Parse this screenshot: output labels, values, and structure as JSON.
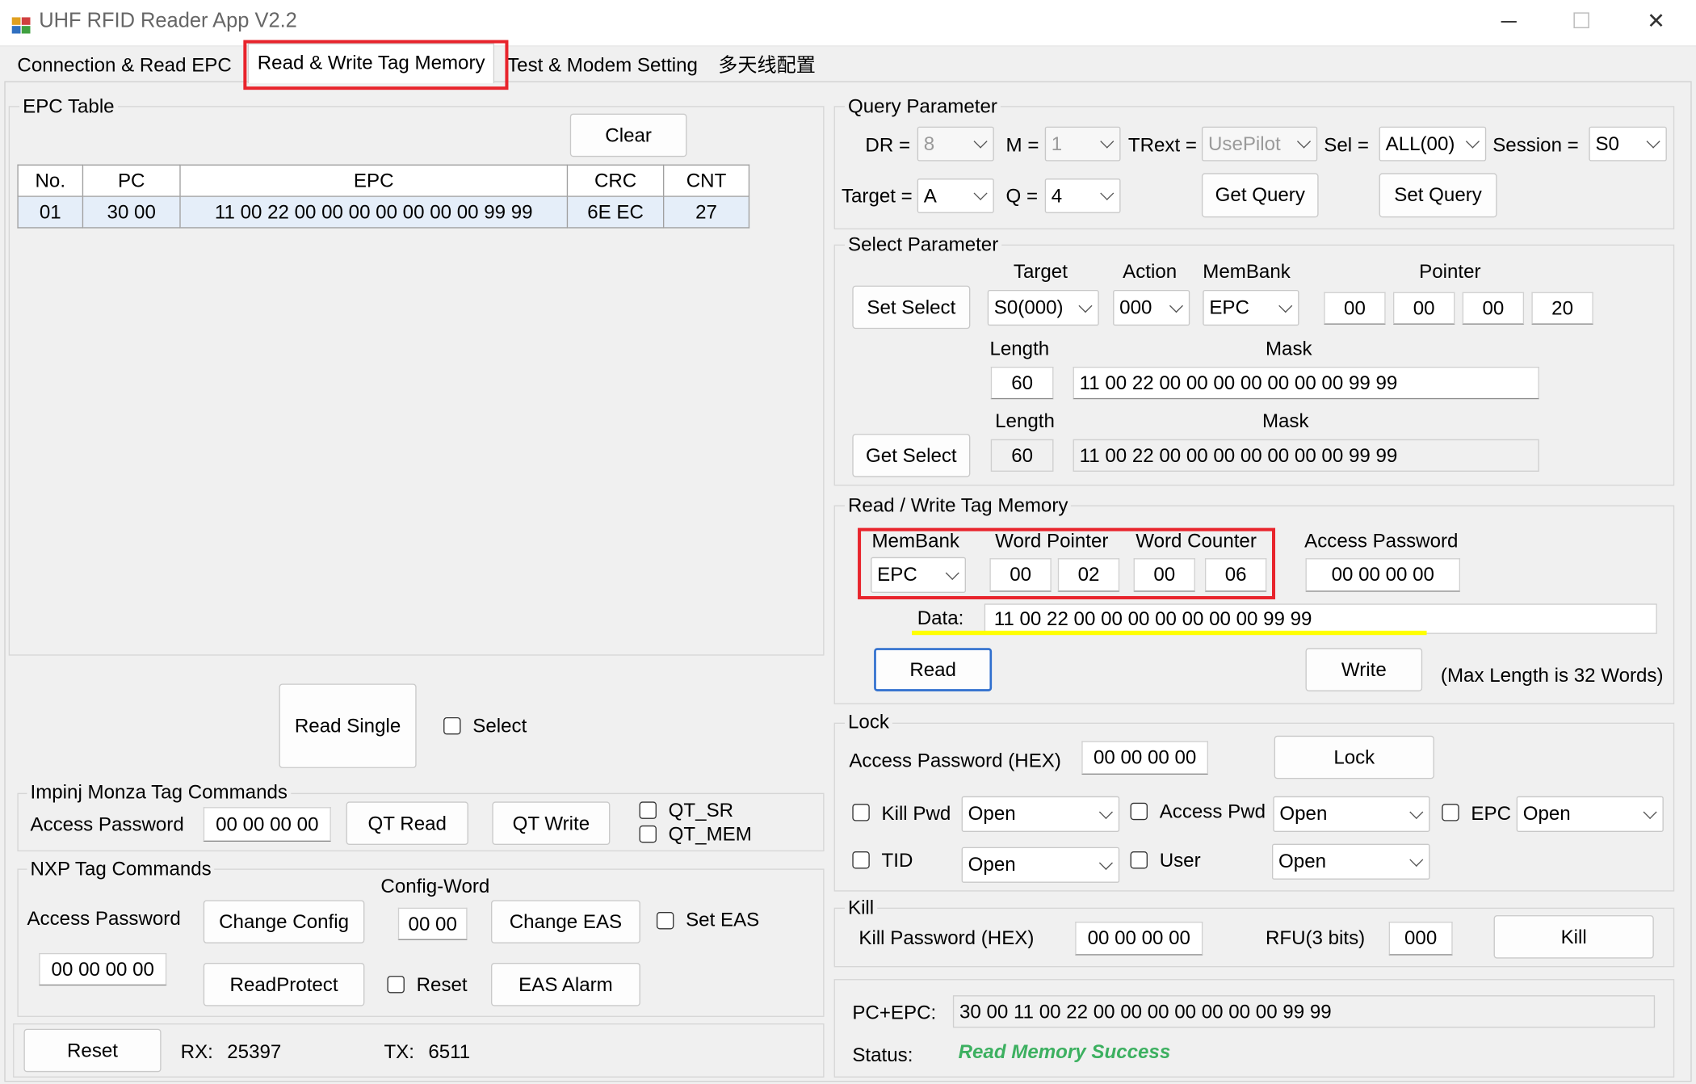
{
  "window": {
    "title": "UHF RFID Reader App V2.2",
    "min": "─",
    "max": "☐",
    "close": "✕"
  },
  "tabs": [
    "Connection & Read EPC",
    "Read & Write Tag Memory",
    "Test & Modem Setting",
    "多天线配置"
  ],
  "epc_table": {
    "label": "EPC Table",
    "clear_button": "Clear",
    "columns": [
      "No.",
      "PC",
      "EPC",
      "CRC",
      "CNT"
    ],
    "rows": [
      [
        "01",
        "30 00",
        "11 00 22 00 00 00 00 00 00 00 99 99",
        "6E EC",
        "27"
      ]
    ]
  },
  "read_single": {
    "button": "Read Single",
    "select_label": "Select"
  },
  "impinj": {
    "label": "Impinj Monza Tag Commands",
    "access_password_label": "Access Password",
    "access_password": "00 00 00 00",
    "qt_read": "QT Read",
    "qt_write": "QT Write",
    "qt_sr": "QT_SR",
    "qt_mem": "QT_MEM"
  },
  "nxp": {
    "label": "NXP Tag Commands",
    "access_password_label": "Access Password",
    "access_password": "00 00 00 00",
    "change_config": "Change Config",
    "config_word_label": "Config-Word",
    "config_word": "00 00",
    "change_eas": "Change EAS",
    "set_eas": "Set EAS",
    "read_protect": "ReadProtect",
    "reset_label": "Reset",
    "eas_alarm": "EAS Alarm"
  },
  "statusbar": {
    "reset_button": "Reset",
    "rx_label": "RX:",
    "rx": "25397",
    "tx_label": "TX:",
    "tx": "6511"
  },
  "query": {
    "label": "Query Parameter",
    "dr_label": "DR =",
    "dr": "8",
    "m_label": "M =",
    "m": "1",
    "trext_label": "TRext =",
    "trext": "UsePilot",
    "sel_label": "Sel =",
    "sel": "ALL(00)",
    "session_label": "Session =",
    "session": "S0",
    "target_label": "Target =",
    "target": "A",
    "q_label": "Q =",
    "q": "4",
    "get_query": "Get Query",
    "set_query": "Set Query"
  },
  "select": {
    "label": "Select Parameter",
    "set_select": "Set Select",
    "get_select": "Get Select",
    "target_label": "Target",
    "target": "S0(000)",
    "action_label": "Action",
    "action": "000",
    "membank_label": "MemBank",
    "membank": "EPC",
    "pointer_label": "Pointer",
    "pointer": [
      "00",
      "00",
      "00",
      "20"
    ],
    "length_label": "Length",
    "length": "60",
    "mask_label": "Mask",
    "mask": "11 00 22 00 00 00 00 00 00 00 99 99",
    "length2": "60",
    "mask2": "11 00 22 00 00 00 00 00 00 00 99 99"
  },
  "rw": {
    "label": "Read / Write Tag Memory",
    "membank_label": "MemBank",
    "membank": "EPC",
    "word_pointer_label": "Word Pointer",
    "word_pointer": [
      "00",
      "02"
    ],
    "word_counter_label": "Word Counter",
    "word_counter": [
      "00",
      "06"
    ],
    "access_password_label": "Access Password",
    "access_password": "00 00 00 00",
    "data_label": "Data:",
    "data": "11  00  22  00  00  00  00  00  00  00  99  99",
    "read": "Read",
    "write": "Write",
    "max_note": "(Max Length is 32 Words)"
  },
  "lock": {
    "label": "Lock",
    "access_password_label": "Access Password (HEX)",
    "access_password": "00 00 00 00",
    "lock_button": "Lock",
    "kill_pwd": "Kill Pwd",
    "kill_pwd_value": "Open",
    "access_pwd": "Access Pwd",
    "access_pwd_value": "Open",
    "epc": "EPC",
    "epc_value": "Open",
    "tid": "TID",
    "tid_value": "Open",
    "user": "User",
    "user_value": "Open"
  },
  "kill": {
    "label": "Kill",
    "kill_password_label": "Kill Password (HEX)",
    "kill_password": "00 00 00 00",
    "rfu_label": "RFU(3 bits)",
    "rfu": "000",
    "kill_button": "Kill"
  },
  "result": {
    "pc_epc_label": "PC+EPC:",
    "pc_epc": "30 00 11 00 22 00 00 00 00 00 00 00 99 99",
    "status_label": "Status:",
    "status": "Read Memory Success",
    "status_color": "#3cb060"
  },
  "colors": {
    "highlight_box": "#e8242c",
    "data_underline": "#ffff00",
    "focus_button": "#2f6fce"
  }
}
